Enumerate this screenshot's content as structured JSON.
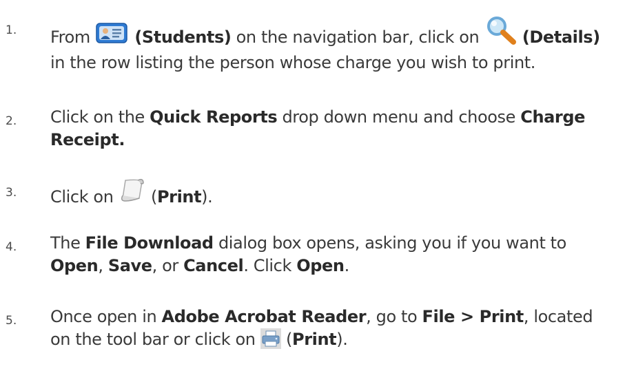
{
  "steps": [
    {
      "number": "1.",
      "line1_a": "From ",
      "students": "(Students)",
      "line1_b": " on the navigation bar, click on ",
      "details": "(Details)",
      "line2": "in the row listing the person whose charge you wish to print.",
      "icons": [
        "students-icon",
        "magnifier-icon"
      ]
    },
    {
      "number": "2.",
      "a": "Click on the ",
      "quick_reports": "Quick Reports",
      "b": " drop down menu and choose ",
      "charge": "Charge",
      "receipt": "Receipt."
    },
    {
      "number": "3.",
      "a": "Click on ",
      "paren_open": " (",
      "print": "Print",
      "paren_close": ").",
      "icons": [
        "scroll-icon"
      ]
    },
    {
      "number": "4.",
      "a": "The ",
      "file_download": "File Download",
      "b": " dialog box opens, asking you if you want to",
      "open": "Open",
      "comma1": ", ",
      "save": "Save",
      "or": ", or ",
      "cancel": "Cancel",
      "click": ".  Click ",
      "open2": "Open",
      "end": "."
    },
    {
      "number": "5.",
      "a": "Once open in ",
      "adobe": "Adobe Acrobat Reader",
      "b": ", go to ",
      "file_print": "File > Print",
      "c": ", located",
      "line2": "on the tool bar or click on ",
      "paren_open": " (",
      "print": "Print",
      "paren_close": ").",
      "icons": [
        "printer-icon"
      ]
    }
  ]
}
